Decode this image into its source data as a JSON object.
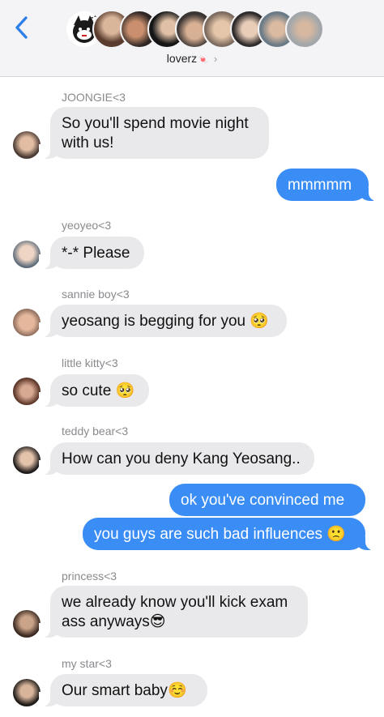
{
  "header": {
    "group_name": "loverz",
    "group_emoji": "🍬",
    "chevron": "›",
    "back_icon": "chevron-left-icon",
    "avatar_count": 9
  },
  "messages": [
    {
      "sender": "JOONGIE<3",
      "text_lines": [
        "So you'll spend movie night",
        "with us!"
      ]
    },
    {
      "text": "mmmmm"
    },
    {
      "sender": "yeoyeo<3",
      "text": "*-* Please"
    },
    {
      "sender": "sannie boy<3",
      "text": "yeosang is begging for you",
      "emoji": "🥺"
    },
    {
      "sender": "little kitty<3",
      "text": "so cute",
      "emoji": "🥺"
    },
    {
      "sender": "teddy bear<3",
      "text": "How can you deny Kang Yeosang.."
    },
    {
      "text": "ok you've convinced me"
    },
    {
      "text": "you guys are such bad influences",
      "emoji": "🙁"
    },
    {
      "sender": "princess<3",
      "text_lines": [
        "we already know you'll kick exam",
        "ass anyways"
      ],
      "emoji": "😎"
    },
    {
      "sender": "my star<3",
      "text": "Our smart baby",
      "emoji": "☺️"
    }
  ],
  "colors": {
    "sent_bubble": "#3a8df5",
    "received_bubble": "#e9e9eb",
    "header_bg": "#f4f4f6",
    "sender_label": "#8a8a8e"
  }
}
